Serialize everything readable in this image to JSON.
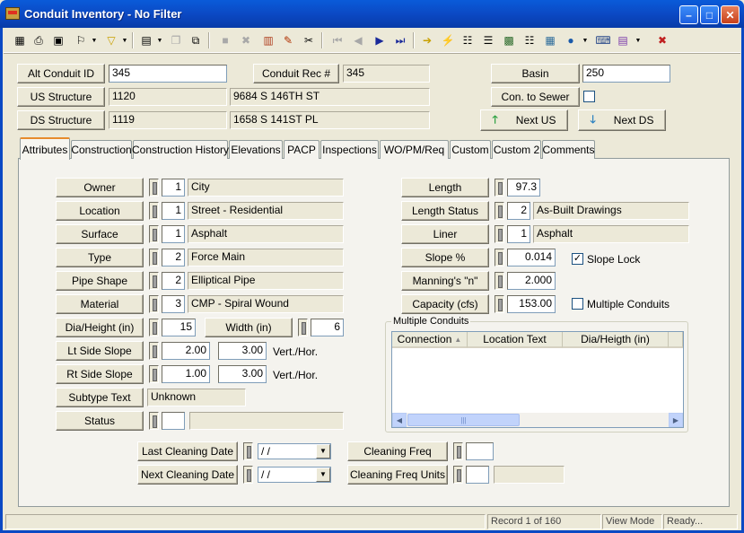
{
  "window": {
    "title": "Conduit Inventory - No Filter"
  },
  "header": {
    "alt_conduit_id_label": "Alt Conduit ID",
    "alt_conduit_id": "345",
    "conduit_rec_label": "Conduit Rec #",
    "conduit_rec": "345",
    "basin_label": "Basin",
    "basin": "250",
    "us_structure_label": "US Structure",
    "us_structure_id": "1120",
    "us_structure_addr": "9684  S  146TH ST",
    "con_to_sewer_label": "Con. to Sewer",
    "ds_structure_label": "DS Structure",
    "ds_structure_id": "1119",
    "ds_structure_addr": "1658  S  141ST PL",
    "next_us_label": "Next US",
    "next_ds_label": "Next DS"
  },
  "tabs": [
    {
      "label": "Attributes"
    },
    {
      "label": "Construction"
    },
    {
      "label": "Construction History"
    },
    {
      "label": "Elevations"
    },
    {
      "label": "PACP"
    },
    {
      "label": "Inspections"
    },
    {
      "label": "WO/PM/Req"
    },
    {
      "label": "Custom"
    },
    {
      "label": "Custom 2"
    },
    {
      "label": "Comments"
    }
  ],
  "attributes": {
    "owner": {
      "label": "Owner",
      "code": "1",
      "text": "City"
    },
    "location": {
      "label": "Location",
      "code": "1",
      "text": "Street - Residential"
    },
    "surface": {
      "label": "Surface",
      "code": "1",
      "text": "Asphalt"
    },
    "type": {
      "label": "Type",
      "code": "2",
      "text": "Force Main"
    },
    "pipe_shape": {
      "label": "Pipe Shape",
      "code": "2",
      "text": "Elliptical Pipe"
    },
    "material": {
      "label": "Material",
      "code": "3",
      "text": "CMP - Spiral Wound"
    },
    "dia_height": {
      "label": "Dia/Height (in)",
      "value": "15"
    },
    "width": {
      "label": "Width (in)",
      "value": "6"
    },
    "lt_side_slope": {
      "label": "Lt Side Slope",
      "vert": "2.00",
      "hor": "3.00",
      "unit": "Vert./Hor."
    },
    "rt_side_slope": {
      "label": "Rt Side Slope",
      "vert": "1.00",
      "hor": "3.00",
      "unit": "Vert./Hor."
    },
    "subtype_text": {
      "label": "Subtype Text",
      "value": "Unknown"
    },
    "status": {
      "label": "Status",
      "code": "",
      "text": ""
    },
    "length": {
      "label": "Length",
      "value": "97.3"
    },
    "length_status": {
      "label": "Length Status",
      "code": "2",
      "text": "As-Built Drawings"
    },
    "liner": {
      "label": "Liner",
      "code": "1",
      "text": "Asphalt"
    },
    "slope": {
      "label": "Slope %",
      "value": "0.014"
    },
    "slope_lock_label": "Slope Lock",
    "mannings": {
      "label": "Manning's \"n\"",
      "value": "2.000"
    },
    "capacity": {
      "label": "Capacity (cfs)",
      "value": "153.00"
    },
    "multiple_conduits_label": "Multiple Conduits",
    "multiple_conduits_group": "Multiple Conduits",
    "multiple_conduits_columns": [
      "Connection",
      "Location Text",
      "Dia/Heigth (in)"
    ],
    "multiple_conduits_rows": []
  },
  "cleaning": {
    "last_label": "Last Cleaning Date",
    "last_value": " / /",
    "next_label": "Next Cleaning Date",
    "next_value": " / /",
    "freq_label": "Cleaning Freq",
    "freq_value": "",
    "freq_units_label": "Cleaning Freq Units",
    "freq_units_code": "",
    "freq_units_text": ""
  },
  "statusbar": {
    "record": "Record 1 of 160",
    "mode": "View Mode",
    "state": "Ready..."
  },
  "colors": {
    "titlebar": "#0B49C4",
    "active_tab": "#E68B2C",
    "panel": "#ECE9D8"
  }
}
